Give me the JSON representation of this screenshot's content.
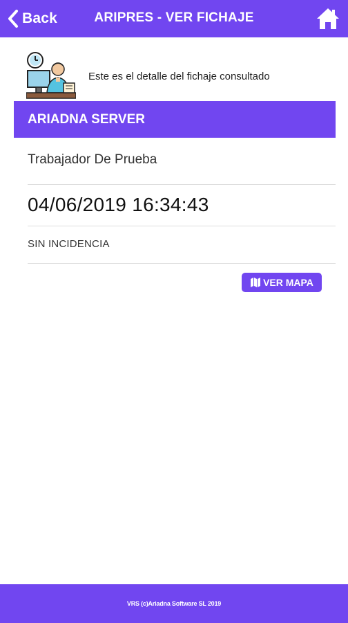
{
  "header": {
    "back_label": "Back",
    "title": "ARIPRES - VER FICHAJE",
    "back_icon": "chevron-left-icon",
    "home_icon": "home-icon"
  },
  "intro": {
    "icon": "worker-at-desk-icon",
    "text": "Este es el detalle del fichaje consultado"
  },
  "record": {
    "company": "ARIADNA SERVER",
    "worker": "Trabajador De Prueba",
    "datetime": "04/06/2019 16:34:43",
    "incident": "SIN INCIDENCIA",
    "map_button_label": "VER MAPA",
    "map_icon": "map-icon"
  },
  "footer": {
    "text": "VRS (c)Ariadna Software SL 2019"
  },
  "colors": {
    "accent": "#7146f0",
    "background": "#ffffff",
    "divider": "#dddddd"
  }
}
